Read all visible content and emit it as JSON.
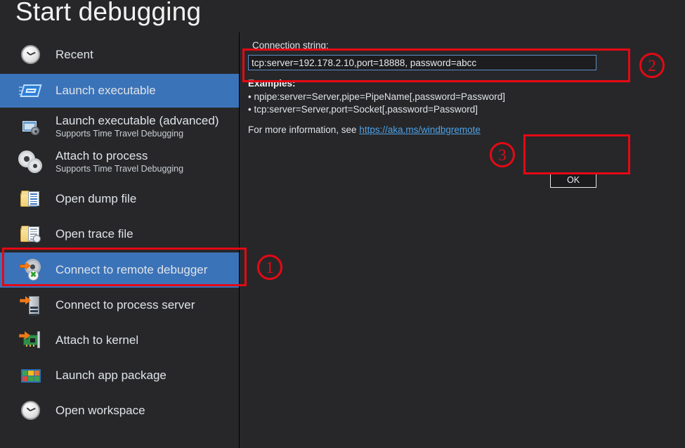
{
  "window": {
    "title": "Start debugging",
    "background": "#272729",
    "accent": "#3b73b9",
    "annotation_color": "#e50914"
  },
  "sidebar": {
    "items": [
      {
        "label": "Recent",
        "sub": "",
        "icon": "clock-icon",
        "selected": false
      },
      {
        "label": "Launch executable",
        "sub": "",
        "icon": "launch-executable-icon",
        "selected": true
      },
      {
        "label": "Launch executable (advanced)",
        "sub": "Supports Time Travel Debugging",
        "icon": "launch-executable-advanced-icon",
        "selected": false
      },
      {
        "label": "Attach to process",
        "sub": "Supports Time Travel Debugging",
        "icon": "gears-icon",
        "selected": false
      },
      {
        "label": "Open dump file",
        "sub": "",
        "icon": "folder-document-icon",
        "selected": false
      },
      {
        "label": "Open trace file",
        "sub": "",
        "icon": "folder-trace-icon",
        "selected": false
      },
      {
        "label": "Connect to remote debugger",
        "sub": "",
        "icon": "remote-debugger-icon",
        "selected": true
      },
      {
        "label": "Connect to process server",
        "sub": "",
        "icon": "process-server-icon",
        "selected": false
      },
      {
        "label": "Attach to kernel",
        "sub": "",
        "icon": "network-card-icon",
        "selected": false
      },
      {
        "label": "Launch app package",
        "sub": "",
        "icon": "app-package-icon",
        "selected": false
      },
      {
        "label": "Open workspace",
        "sub": "",
        "icon": "clock-icon",
        "selected": false
      }
    ]
  },
  "panel": {
    "connection_label": "Connection string:",
    "connection_value": "tcp:server=192.178.2.10,port=18888, password=abcc",
    "connection_placeholder": "",
    "examples_title": "Examples:",
    "example_1": "• npipe:server=Server,pipe=PipeName[,password=Password]",
    "example_2": "• tcp:server=Server,port=Socket[,password=Password]",
    "more_info_prefix": "For more information, see ",
    "more_info_link": "https://aka.ms/windbgremote",
    "ok_label": "OK"
  },
  "annotations": {
    "step_1": "①",
    "step_2": "②",
    "step_3": "③",
    "step_1_number": "1",
    "step_2_number": "2",
    "step_3_number": "3"
  }
}
